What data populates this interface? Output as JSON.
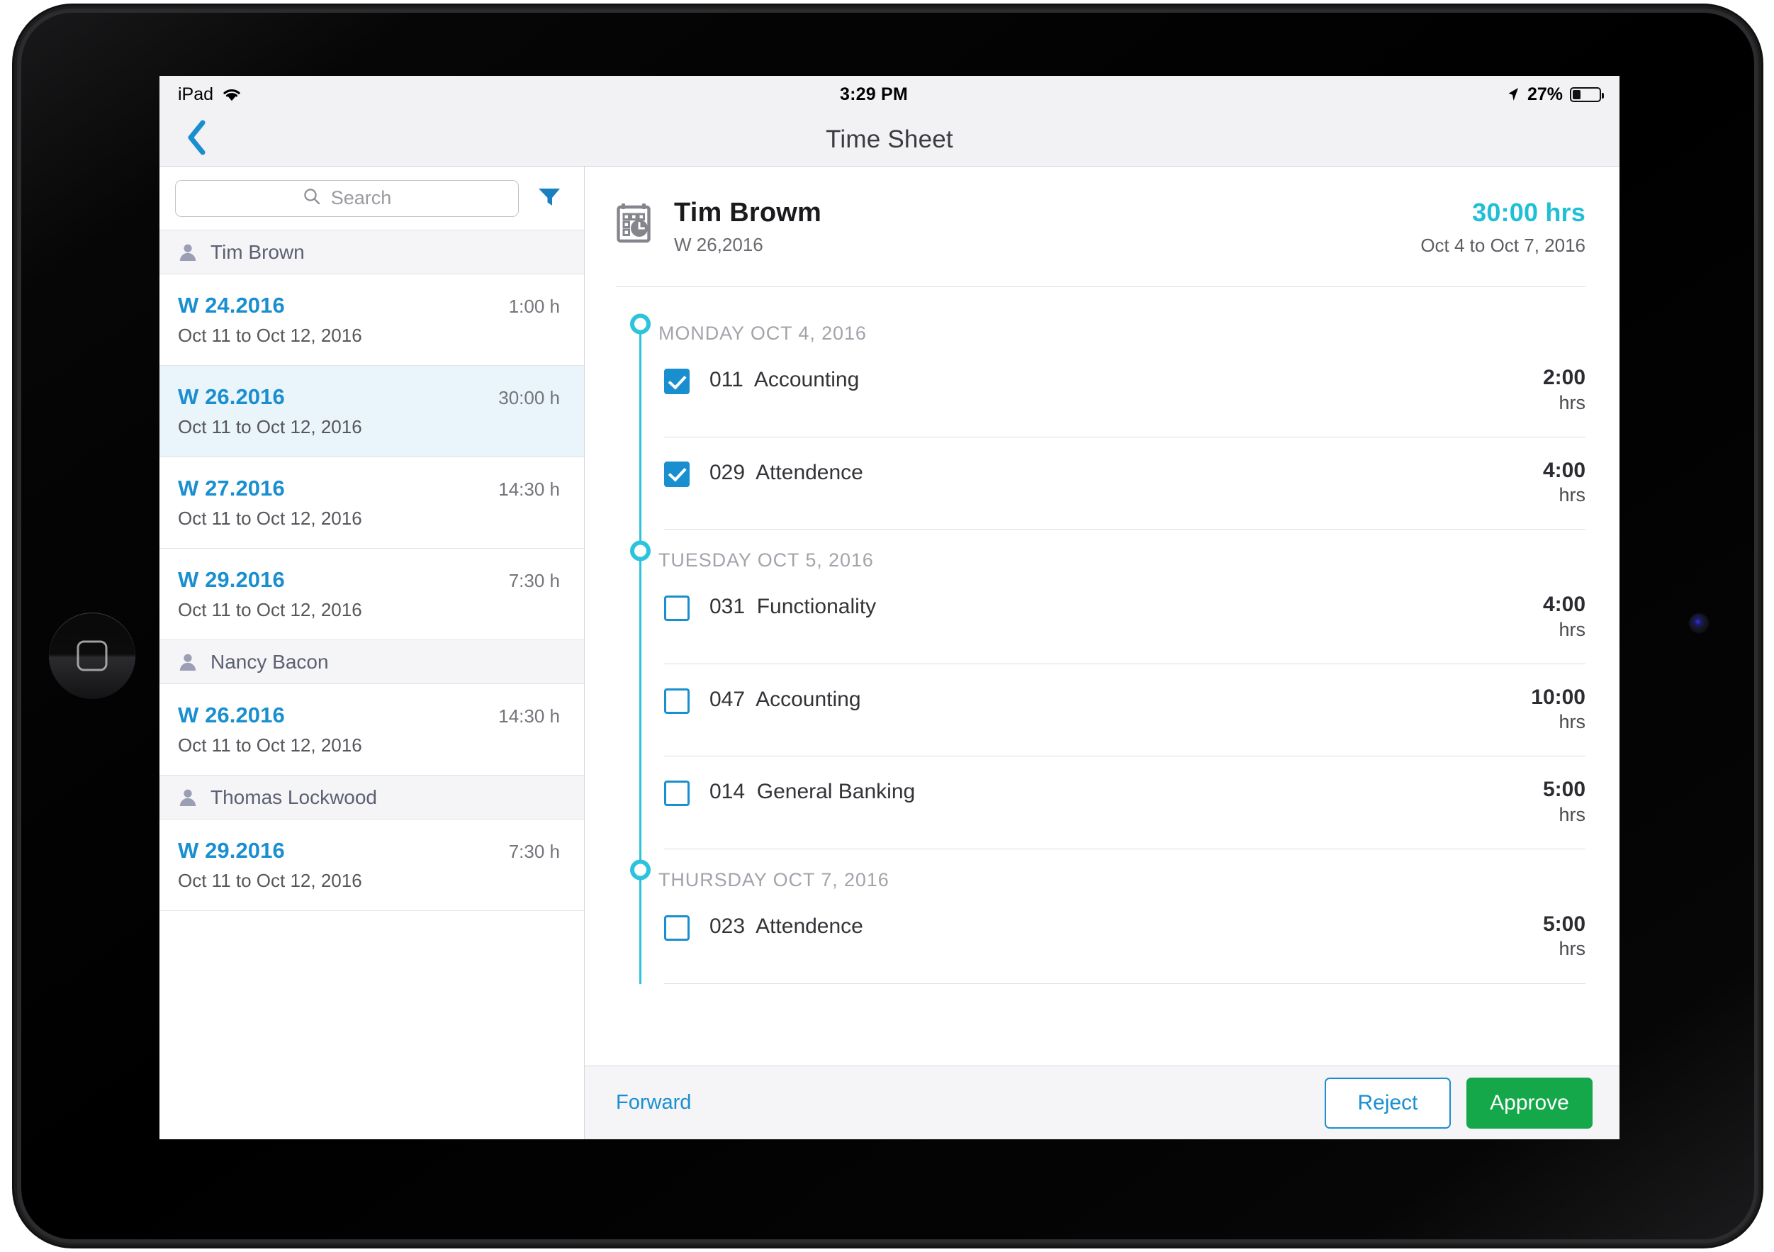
{
  "status_bar": {
    "device_label": "iPad",
    "wifi_icon": "wifi-icon",
    "time": "3:29 PM",
    "location_icon": "location-arrow-icon",
    "battery_percent": "27%",
    "battery_level": 27
  },
  "nav": {
    "back_icon": "chevron-left-icon",
    "title": "Time Sheet"
  },
  "sidebar": {
    "search": {
      "icon": "search-icon",
      "placeholder": "Search",
      "value": ""
    },
    "filter_icon": "filter-icon",
    "groups": [
      {
        "person": "Tim Brown",
        "avatar_icon": "person-icon",
        "weeks": [
          {
            "label": "W 24.2016",
            "hours": "1:00 h",
            "range": "Oct 11 to Oct 12, 2016",
            "selected": false
          },
          {
            "label": "W 26.2016",
            "hours": "30:00 h",
            "range": "Oct 11 to Oct 12, 2016",
            "selected": true
          },
          {
            "label": "W 27.2016",
            "hours": "14:30 h",
            "range": "Oct 11 to Oct 12, 2016",
            "selected": false
          },
          {
            "label": "W 29.2016",
            "hours": "7:30 h",
            "range": "Oct 11 to Oct 12, 2016",
            "selected": false
          }
        ]
      },
      {
        "person": "Nancy Bacon",
        "avatar_icon": "person-icon",
        "weeks": [
          {
            "label": "W 26.2016",
            "hours": "14:30 h",
            "range": "Oct 11 to Oct 12, 2016",
            "selected": false
          }
        ]
      },
      {
        "person": "Thomas Lockwood",
        "avatar_icon": "person-icon",
        "weeks": [
          {
            "label": "W 29.2016",
            "hours": "7:30 h",
            "range": "Oct 11 to Oct 12, 2016",
            "selected": false
          }
        ]
      }
    ]
  },
  "detail": {
    "icon": "calendar-clock-icon",
    "employee_name": "Tim Browm",
    "week_label": "W 26,2016",
    "total_hours": "30:00 hrs",
    "date_range": "Oct 4 to Oct 7, 2016",
    "days": [
      {
        "title": "MONDAY OCT 4, 2016",
        "entries": [
          {
            "code": "011",
            "task": "Accounting",
            "hours": "2:00",
            "unit": "hrs",
            "checked": true
          },
          {
            "code": "029",
            "task": "Attendence",
            "hours": "4:00",
            "unit": "hrs",
            "checked": true
          }
        ]
      },
      {
        "title": "TUESDAY OCT 5, 2016",
        "entries": [
          {
            "code": "031",
            "task": "Functionality",
            "hours": "4:00",
            "unit": "hrs",
            "checked": false
          },
          {
            "code": "047",
            "task": "Accounting",
            "hours": "10:00",
            "unit": "hrs",
            "checked": false
          },
          {
            "code": "014",
            "task": "General Banking",
            "hours": "5:00",
            "unit": "hrs",
            "checked": false
          }
        ]
      },
      {
        "title": "THURSDAY OCT 7, 2016",
        "entries": [
          {
            "code": "023",
            "task": "Attendence",
            "hours": "5:00",
            "unit": "hrs",
            "checked": false
          }
        ]
      }
    ],
    "footer": {
      "forward_label": "Forward",
      "reject_label": "Reject",
      "approve_label": "Approve"
    }
  },
  "colors": {
    "accent_blue": "#1a8fd0",
    "accent_teal": "#2cc3dc",
    "approve_green": "#14a84a",
    "selected_row": "#eaf4fb"
  }
}
